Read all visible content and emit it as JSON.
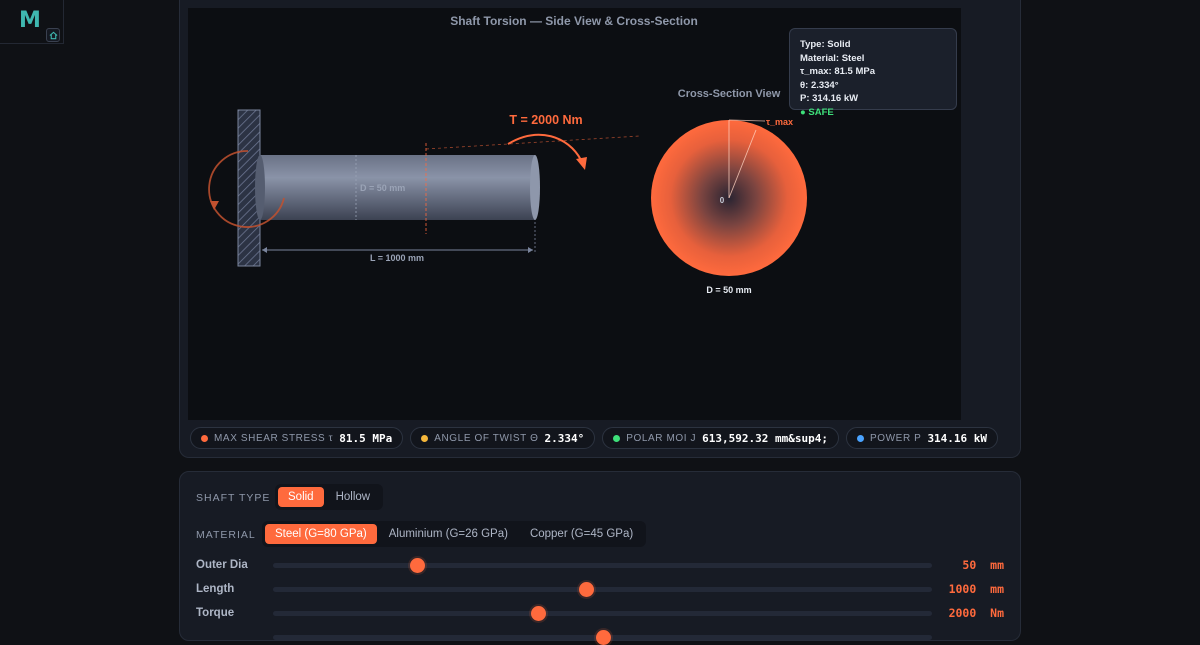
{
  "app": {
    "logo_letter": "M"
  },
  "diagram": {
    "title": "Shaft Torsion — Side View & Cross-Section",
    "torque_label": "T = 2000 Nm",
    "diameter_label": "D = 50 mm",
    "length_label": "L = 1000 mm",
    "cross_section_title": "Cross-Section View",
    "tau_max_label": "τ_max",
    "center_label": "0",
    "cross_section_diameter": "D = 50 mm"
  },
  "tooltip": {
    "type": "Type: Solid",
    "material": "Material: Steel",
    "tau_max": "τ_max: 81.5 MPa",
    "theta": "θ: 2.334°",
    "power": "P: 314.16 kW",
    "status": "● SAFE"
  },
  "metrics": [
    {
      "label": "MAX SHEAR STRESS τ",
      "value": "81.5 MPa",
      "color": "#ff6a3d"
    },
    {
      "label": "ANGLE OF TWIST Θ",
      "value": "2.334°",
      "color": "#f5b73b"
    },
    {
      "label": "POLAR MOI J",
      "value": "613,592.32 mm&sup4;",
      "color": "#3ee07a"
    },
    {
      "label": "POWER P",
      "value": "314.16 kW",
      "color": "#4aa3ff"
    }
  ],
  "controls": {
    "shaft_type": {
      "label": "SHAFT TYPE",
      "options": [
        "Solid",
        "Hollow"
      ],
      "selected": "Solid"
    },
    "material": {
      "label": "MATERIAL",
      "options": [
        "Steel (G=80 GPa)",
        "Aluminium (G=26 GPa)",
        "Copper (G=45 GPa)"
      ],
      "selected": "Steel (G=80 GPa)"
    },
    "sliders": [
      {
        "label": "Outer Dia",
        "value": "50",
        "unit": "mm",
        "fraction": 0.218
      },
      {
        "label": "Length",
        "value": "1000",
        "unit": "mm",
        "fraction": 0.475
      },
      {
        "label": "Torque",
        "value": "2000",
        "unit": "Nm",
        "fraction": 0.402
      }
    ]
  },
  "colors": {
    "accent": "#ff6a3d",
    "safe": "#3ee07a"
  }
}
